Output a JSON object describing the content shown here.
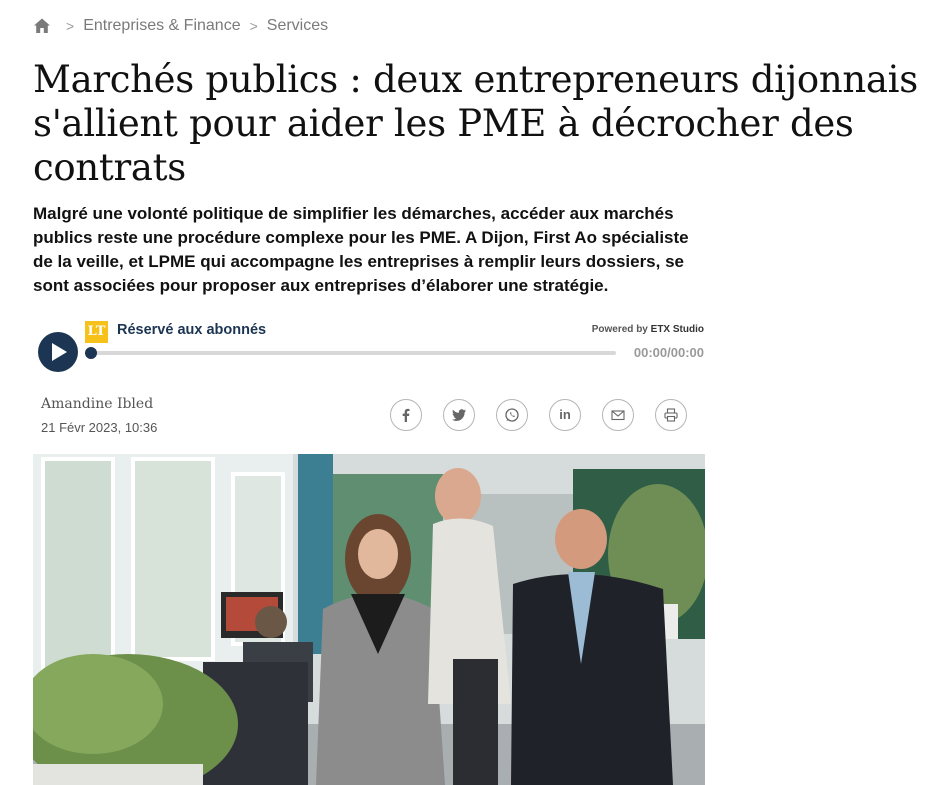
{
  "breadcrumb": {
    "home_icon": "home-icon",
    "items": [
      "Entreprises & Finance",
      "Services"
    ],
    "separator": ">"
  },
  "article": {
    "title": "Marchés publics : deux entrepreneurs dijonnais s'allient pour aider les PME à décrocher des contrats",
    "lead": "Malgré une volonté politique de simplifier les démarches, accéder aux marchés publics reste une procédure complexe pour les PME. A Dijon, First Ao spécialiste de la veille, et LPME qui accompagne les entreprises à remplir leurs dossiers, se sont associées pour proposer aux entreprises d’élaborer une stratégie.",
    "author": "Amandine Ibled",
    "date": "21 Févr 2023, 10:36"
  },
  "player": {
    "badge": "LT",
    "label": "Réservé aux abonnés",
    "powered_by": "Powered by",
    "provider": "ETX Studio",
    "time": "00:00/00:00",
    "progress": 0,
    "accent": "#1c3553",
    "badge_color": "#f5c11a"
  },
  "share": {
    "icons": [
      "facebook-icon",
      "twitter-icon",
      "whatsapp-icon",
      "linkedin-icon",
      "email-icon",
      "print-icon"
    ],
    "linkedin_text": "in"
  },
  "photo": {
    "description_icon": "article-photo"
  }
}
